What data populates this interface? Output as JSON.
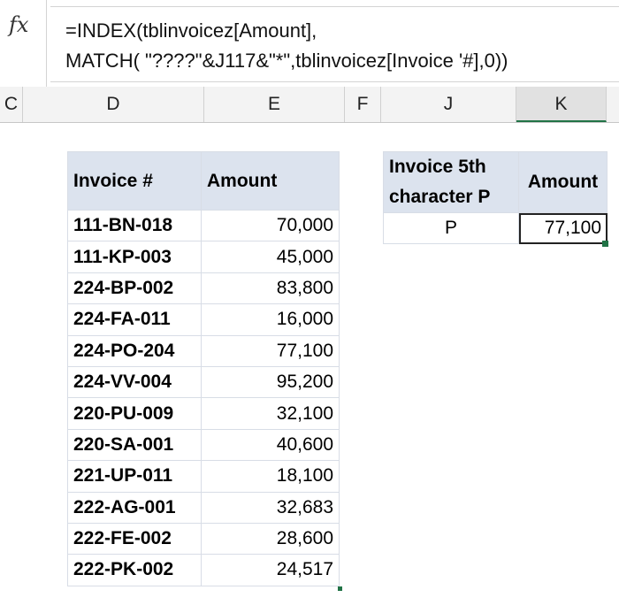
{
  "formula_bar": {
    "fx_label": "fx",
    "line1": "=INDEX(tblinvoicez[Amount],",
    "line2": "MATCH( \"????\"&J117&\"*\",tblinvoicez[Invoice '#],0))"
  },
  "columns": [
    {
      "label": "C"
    },
    {
      "label": "D"
    },
    {
      "label": "E"
    },
    {
      "label": "F"
    },
    {
      "label": "J"
    },
    {
      "label": "K"
    }
  ],
  "invoice_table": {
    "headers": [
      "Invoice #",
      "Amount"
    ],
    "rows": [
      [
        "111-BN-018",
        "70,000"
      ],
      [
        "111-KP-003",
        "45,000"
      ],
      [
        "224-BP-002",
        "83,800"
      ],
      [
        "224-FA-011",
        "16,000"
      ],
      [
        "224-PO-204",
        "77,100"
      ],
      [
        "224-VV-004",
        "95,200"
      ],
      [
        "220-PU-009",
        "32,100"
      ],
      [
        "220-SA-001",
        "40,600"
      ],
      [
        "221-UP-011",
        "18,100"
      ],
      [
        "222-AG-001",
        "32,683"
      ],
      [
        "222-FE-002",
        "28,600"
      ],
      [
        "222-PK-002",
        "24,517"
      ]
    ]
  },
  "lookup": {
    "header_left_line1": "Invoice 5th",
    "header_left_line2": "character P",
    "header_right": "Amount",
    "input": "P",
    "result": "77,100"
  },
  "colors": {
    "header_fill": "#dce3ee",
    "selection_green": "#217346"
  }
}
